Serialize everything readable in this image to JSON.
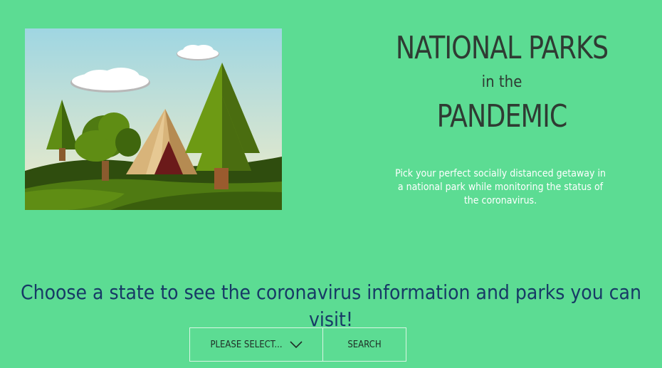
{
  "header": {
    "title_line1": "NATIONAL PARKS",
    "title_line2": "in the",
    "title_line3": "PANDEMIC",
    "tagline": "Pick your perfect socially distanced getaway in a national park while monitoring the status of the coronavirus."
  },
  "prompt": {
    "text": "Choose a state to see the coronavirus information and parks you can visit!"
  },
  "controls": {
    "select_label": "PLEASE SELECT...",
    "search_label": "SEARCH"
  },
  "colors": {
    "background": "#5cdc93",
    "prompt_text": "#173a66",
    "title_text": "#2f3b33"
  },
  "icons": {
    "dropdown": "chevron-down-icon"
  }
}
